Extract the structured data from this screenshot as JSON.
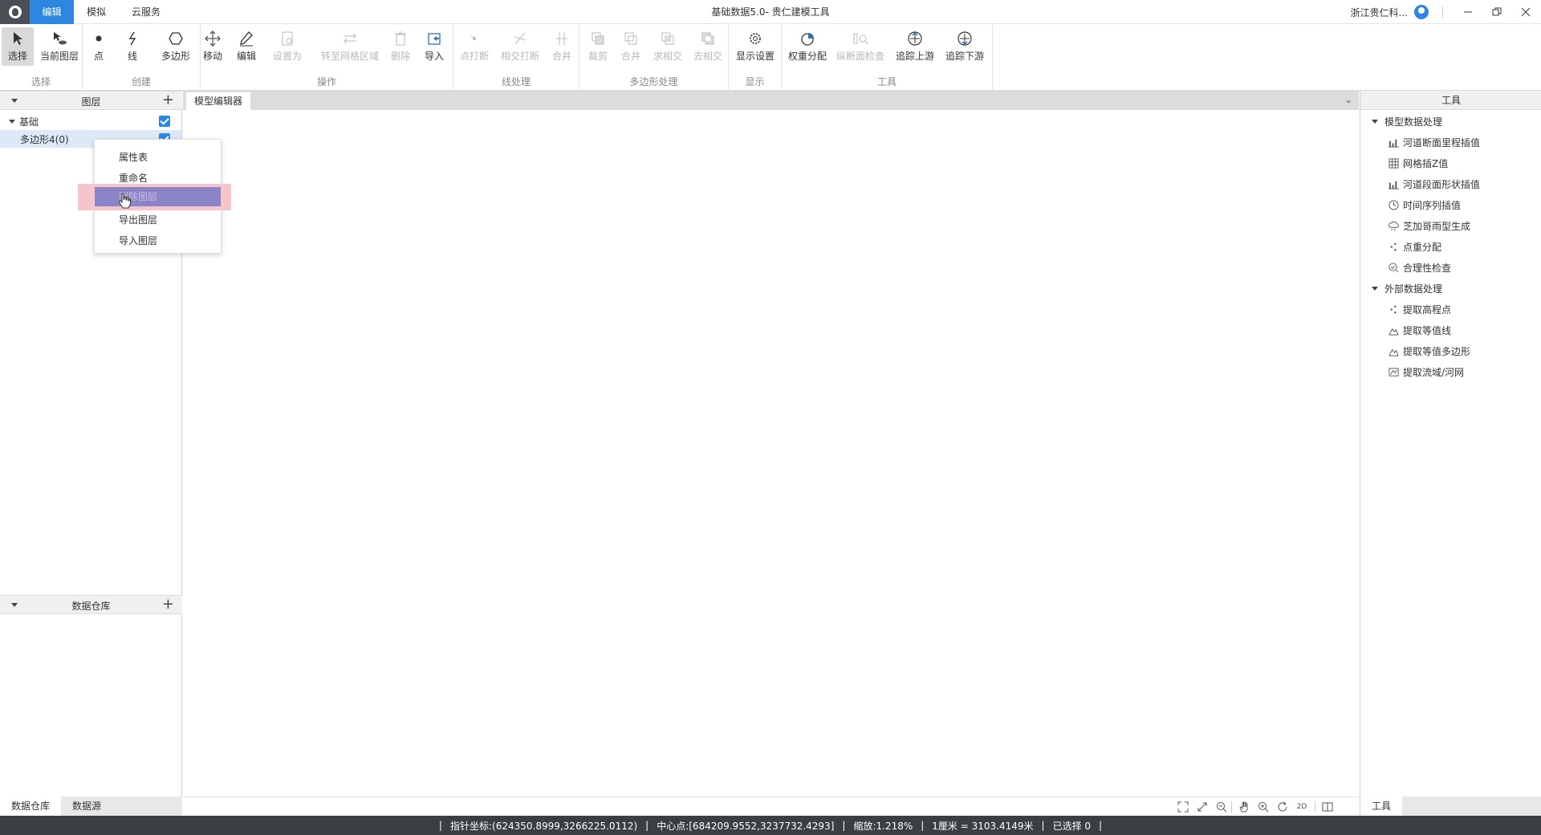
{
  "titlebar": {
    "tabs": [
      "编辑",
      "模拟",
      "云服务"
    ],
    "active_tab": "编辑",
    "window_title": "基础数据5.0- 贵仁建模工具",
    "user_name": "浙江贵仁科...",
    "controls": [
      "minimize",
      "restore",
      "close"
    ]
  },
  "ribbon": {
    "groups": [
      {
        "label": "选择",
        "buttons": [
          {
            "label": "选择",
            "icon": "pointer-icon",
            "state": "selected"
          },
          {
            "label": "当前图层",
            "icon": "current-layer-icon",
            "state": "normal"
          }
        ]
      },
      {
        "label": "创建",
        "buttons": [
          {
            "label": "点",
            "icon": "point-icon",
            "state": "normal"
          },
          {
            "label": "线",
            "icon": "line-icon",
            "state": "normal"
          },
          {
            "label": "多边形",
            "icon": "polygon-icon",
            "state": "normal"
          }
        ]
      },
      {
        "label": "操作",
        "buttons": [
          {
            "label": "移动",
            "icon": "move-icon",
            "state": "normal"
          },
          {
            "label": "编辑",
            "icon": "pen-icon",
            "state": "normal"
          },
          {
            "label": "设置为",
            "icon": "set-as-icon",
            "state": "disabled"
          },
          {
            "label": "转至网格区域",
            "icon": "swap-icon",
            "state": "disabled"
          },
          {
            "label": "删除",
            "icon": "trash-icon",
            "state": "disabled"
          },
          {
            "label": "导入",
            "icon": "import-icon",
            "state": "normal"
          }
        ]
      },
      {
        "label": "线处理",
        "buttons": [
          {
            "label": "点打断",
            "icon": "point-break-icon",
            "state": "disabled"
          },
          {
            "label": "相交打断",
            "icon": "intersect-break-icon",
            "state": "disabled"
          },
          {
            "label": "合并",
            "icon": "merge-line-icon",
            "state": "disabled"
          }
        ]
      },
      {
        "label": "多边形处理",
        "buttons": [
          {
            "label": "裁剪",
            "icon": "clip-icon",
            "state": "disabled"
          },
          {
            "label": "合并",
            "icon": "union-icon",
            "state": "disabled"
          },
          {
            "label": "求相交",
            "icon": "intersect-icon",
            "state": "disabled"
          },
          {
            "label": "去相交",
            "icon": "remove-intersect-icon",
            "state": "disabled"
          }
        ]
      },
      {
        "label": "显示",
        "buttons": [
          {
            "label": "显示设置",
            "icon": "gear-icon",
            "state": "normal"
          }
        ]
      },
      {
        "label": "工具",
        "buttons": [
          {
            "label": "权重分配",
            "icon": "pie-icon",
            "state": "normal"
          },
          {
            "label": "纵断面检查",
            "icon": "profile-check-icon",
            "state": "disabled"
          },
          {
            "label": "追踪上游",
            "icon": "trace-up-icon",
            "state": "normal"
          },
          {
            "label": "追踪下游",
            "icon": "trace-down-icon",
            "state": "normal"
          }
        ]
      }
    ]
  },
  "layers_panel": {
    "title": "图层",
    "tree": [
      {
        "label": "基础",
        "level": 0,
        "checked": true
      },
      {
        "label": "多边形4(0)",
        "level": 1,
        "checked": true,
        "selected": true
      }
    ]
  },
  "warehouse_panel": {
    "title": "数据仓库"
  },
  "left_bottom_tabs": [
    "数据仓库",
    "数据源"
  ],
  "editor": {
    "tab_label": "模型编辑器",
    "view_mode": "2D"
  },
  "context_menu": {
    "items": [
      "属性表",
      "重命名",
      "删除图层",
      "导出图层",
      "导入图层"
    ],
    "highlighted_index": 2
  },
  "tools_panel": {
    "title": "工具",
    "sections": [
      {
        "label": "模型数据处理",
        "items": [
          {
            "label": "河道断面里程插值",
            "icon": "bar-chart-icon"
          },
          {
            "label": "网格插Z值",
            "icon": "grid-icon"
          },
          {
            "label": "河道段面形状插值",
            "icon": "bar-chart-icon"
          },
          {
            "label": "时间序列插值",
            "icon": "clock-icon"
          },
          {
            "label": "芝加哥雨型生成",
            "icon": "rain-cloud-icon"
          },
          {
            "label": "点重分配",
            "icon": "scatter-icon"
          },
          {
            "label": "合理性检查",
            "icon": "check-magnifier-icon"
          }
        ]
      },
      {
        "label": "外部数据处理",
        "items": [
          {
            "label": "提取高程点",
            "icon": "scatter-icon"
          },
          {
            "label": "提取等值线",
            "icon": "mountain-icon"
          },
          {
            "label": "提取等值多边形",
            "icon": "mountain-icon"
          },
          {
            "label": "提取流域/河网",
            "icon": "map-icon"
          }
        ]
      }
    ],
    "bottom_tab": "工具"
  },
  "statusbar": {
    "pointer_label": "指针坐标:",
    "pointer_value": "(624350.8999,3266225.0112)",
    "center_label": "中心点:",
    "center_value": "[684209.9552,3237732.4293]",
    "zoom_label": "缩放:",
    "zoom_value": "1.218%",
    "scale_text": "1厘米 = 3103.4149米",
    "selected_text": "已选择 0"
  }
}
